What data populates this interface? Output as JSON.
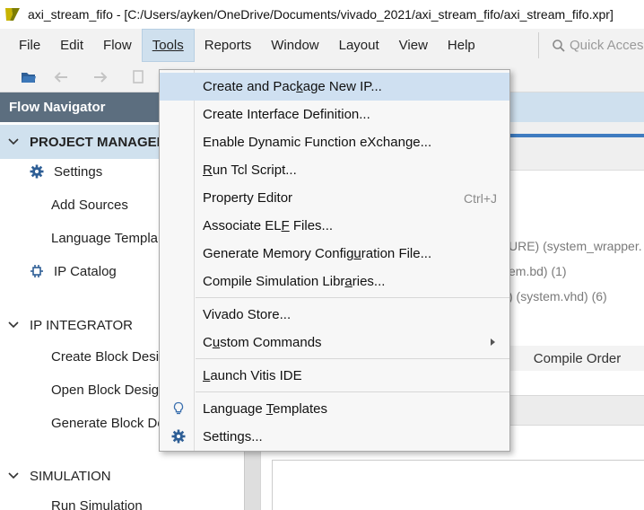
{
  "window": {
    "title": "axi_stream_fifo - [C:/Users/ayken/OneDrive/Documents/vivado_2021/axi_stream_fifo/axi_stream_fifo.xpr]",
    "app_icon": "vivado-logo-icon"
  },
  "menubar": {
    "items": [
      "File",
      "Edit",
      "Flow",
      "Tools",
      "Reports",
      "Window",
      "Layout",
      "View",
      "Help"
    ],
    "active": "Tools",
    "quick_access_placeholder": "Quick Access"
  },
  "flow_navigator": {
    "header": "Flow Navigator",
    "sections": [
      {
        "label": "PROJECT MANAGER",
        "expanded": true,
        "selected": true,
        "items": [
          {
            "label": "Settings",
            "icon": "gear-icon"
          },
          {
            "label": "Add Sources",
            "icon": ""
          },
          {
            "label": "Language Templa",
            "icon": ""
          },
          {
            "label": "IP Catalog",
            "icon": "ip-catalog-icon"
          }
        ]
      },
      {
        "label": "IP INTEGRATOR",
        "expanded": true,
        "selected": false,
        "items": [
          {
            "label": "Create Block Desig"
          },
          {
            "label": "Open Block Design"
          },
          {
            "label": "Generate Block De"
          }
        ]
      },
      {
        "label": "SIMULATION",
        "expanded": true,
        "selected": false,
        "items": [
          {
            "label": "Run Simulation"
          }
        ]
      }
    ]
  },
  "background_content": {
    "sources": [
      "URE) (system_wrapper.",
      "em.bd) (1)",
      ") (system.vhd) (6)"
    ],
    "tab": "Compile Order"
  },
  "tools_menu": {
    "items": [
      {
        "before": "Create and Pac",
        "u": "k",
        "after": "age New IP...",
        "highlighted": true
      },
      {
        "before": "Create Interface Definition...",
        "u": "",
        "after": ""
      },
      {
        "before": "Enable Dynamic Function eXchange...",
        "u": "",
        "after": ""
      },
      {
        "before": "",
        "u": "R",
        "after": "un Tcl Script..."
      },
      {
        "before": "Property Editor",
        "u": "",
        "after": "",
        "shortcut": "Ctrl+J"
      },
      {
        "before": "Associate EL",
        "u": "F",
        "after": " Files..."
      },
      {
        "before": "Generate Memory Config",
        "u": "u",
        "after": "ration File..."
      },
      {
        "before": "Compile Simulation Libr",
        "u": "a",
        "after": "ries..."
      },
      {
        "before": "Vivado Store...",
        "u": "",
        "after": ""
      },
      {
        "before": "C",
        "u": "u",
        "after": "stom Commands",
        "submenu": true
      },
      {
        "before": "",
        "u": "L",
        "after": "aunch Vitis IDE"
      },
      {
        "before": "Language ",
        "u": "T",
        "after": "emplates",
        "icon": "lightbulb-icon"
      },
      {
        "before": "Settings...",
        "u": "",
        "after": "",
        "icon": "gear-icon"
      }
    ]
  },
  "colors": {
    "navigator_header": "#5c6e7f",
    "selection": "#cfe0f1",
    "accent_line": "#3f7cc0"
  }
}
